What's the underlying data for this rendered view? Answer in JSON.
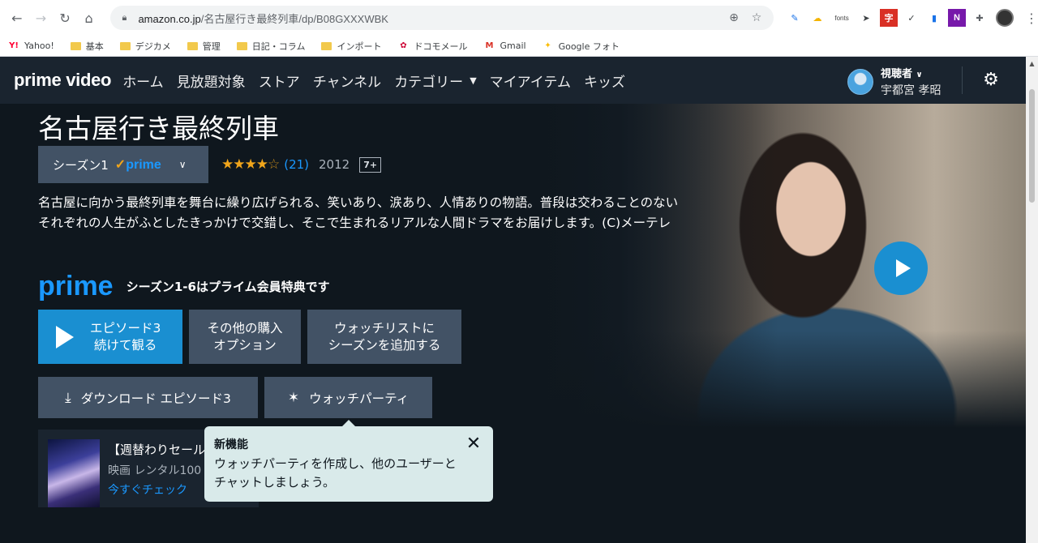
{
  "browser": {
    "url_host": "amazon.co.jp",
    "url_path": "/名古屋行き最終列車/dp/B08GXXXWBK",
    "extension_fonts_label": "fonts"
  },
  "bookmarks": [
    {
      "label": "Yahoo!",
      "icon": "yahoo-icon"
    },
    {
      "label": "基本",
      "icon": "folder-icon"
    },
    {
      "label": "デジカメ",
      "icon": "folder-icon"
    },
    {
      "label": "管理",
      "icon": "folder-icon"
    },
    {
      "label": "日記・コラム",
      "icon": "folder-icon"
    },
    {
      "label": "インポート",
      "icon": "folder-icon"
    },
    {
      "label": "ドコモメール",
      "icon": "docomo-icon"
    },
    {
      "label": "Gmail",
      "icon": "gmail-icon"
    },
    {
      "label": "Google フォト",
      "icon": "google-photos-icon"
    }
  ],
  "header": {
    "logo": "prime video",
    "nav": [
      "ホーム",
      "見放題対象",
      "ストア",
      "チャンネル",
      "カテゴリー",
      "マイアイテム",
      "キッズ"
    ],
    "profile_role": "視聴者",
    "profile_name": "宇都宮 孝昭"
  },
  "title": {
    "name": "名古屋行き最終列車",
    "season": "シーズン1",
    "prime_badge": "prime",
    "stars": "★★★★",
    "star_empty": "☆",
    "rating_value": 4,
    "rating_max": 5,
    "rating_count": "(21)",
    "year": "2012",
    "age_rating": "7+"
  },
  "synopsis": "名古屋に向かう最終列車を舞台に繰り広げられる、笑いあり、涙あり、人情ありの物語。普段は交わることのないそれぞれの人生がふとしたきっかけで交錯し、そこで生まれるリアルな人間ドラマをお届けします。(C)メーテレ",
  "prime_offer": {
    "logo": "prime",
    "label": "シーズン1-6はプライム会員特典です"
  },
  "buttons": {
    "play_line1": "エピソード3",
    "play_line2": "続けて観る",
    "other_line1": "その他の購入",
    "other_line2": "オプション",
    "watchlist_line1": "ウォッチリストに",
    "watchlist_line2": "シーズンを追加する",
    "download": "ダウンロード エピソード3",
    "watch_party": "ウォッチパーティ"
  },
  "promo": {
    "title": "【週替わりセール",
    "subtitle": "映画 レンタル100",
    "link": "今すぐチェック"
  },
  "tooltip": {
    "title": "新機能",
    "line1": "ウォッチパーティを作成し、他のユーザーと",
    "line2": "チャットしましょう。"
  },
  "colors": {
    "page_bg": "#0f171e",
    "header_bg": "#1a242f",
    "accent_blue": "#1a98ff",
    "play_blue": "#1a8fd1",
    "button_gray": "#425265",
    "star_gold": "#f0a51b",
    "tooltip_bg": "#d9eaea"
  }
}
